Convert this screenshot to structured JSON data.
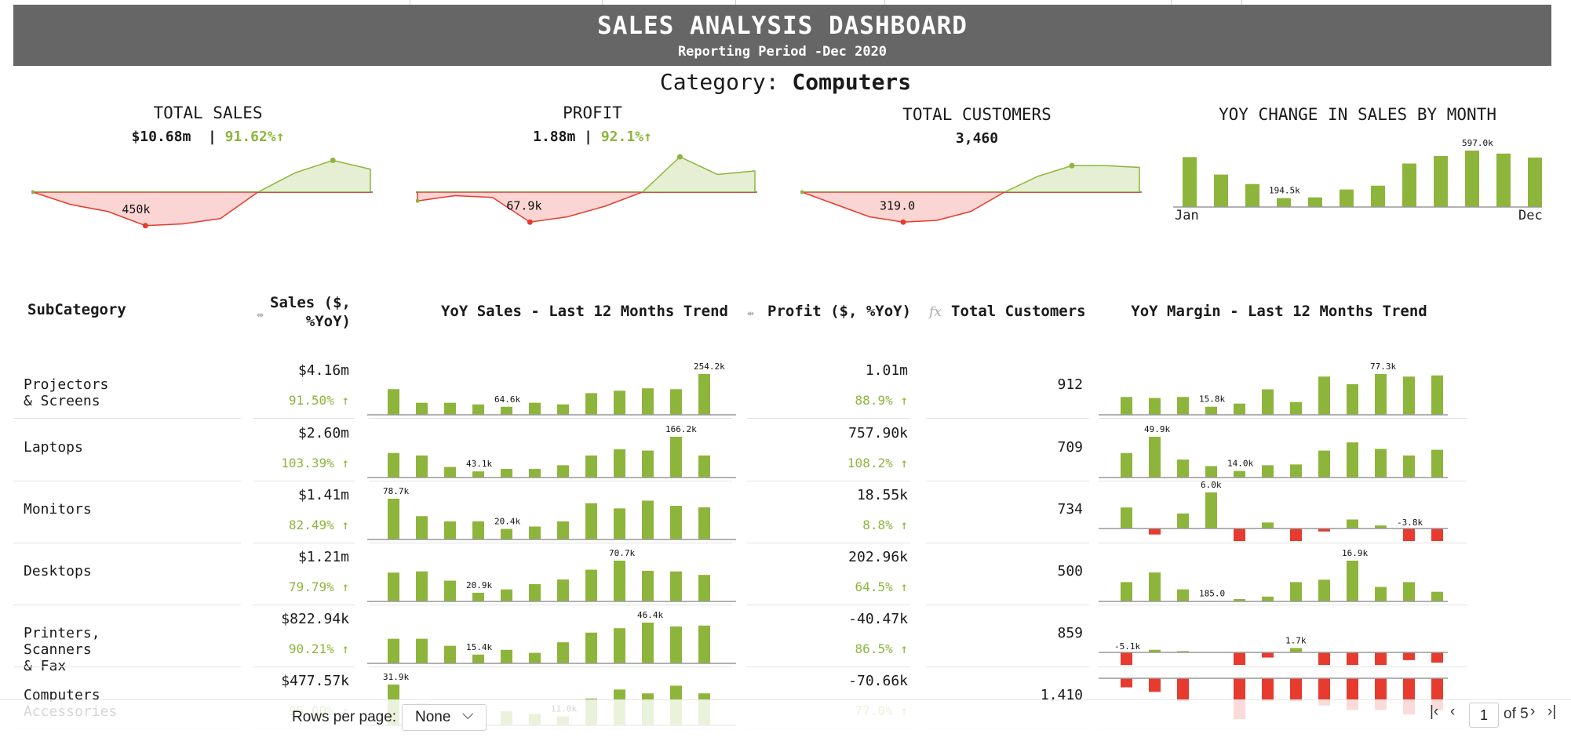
{
  "header": {
    "title": "SALES ANALYSIS DASHBOARD",
    "subtitle": "Reporting Period -Dec 2020"
  },
  "category": {
    "label": "Category:",
    "value": "Computers"
  },
  "kpis": {
    "sales": {
      "title": "TOTAL SALES",
      "value": "$10.68m",
      "sep": "|",
      "pct": "91.62%",
      "low_label": "450k"
    },
    "profit": {
      "title": "PROFIT",
      "value": "1.88m",
      "sep": "|",
      "pct": "92.1%",
      "low_label": "67.9k"
    },
    "customers": {
      "title": "TOTAL CUSTOMERS",
      "value": "3,460",
      "low_label": "319.0"
    },
    "yoy": {
      "title": "YOY CHANGE IN SALES BY MONTH",
      "start": "Jan",
      "end": "Dec",
      "peak_label": "597.0k",
      "low_label": "194.5k"
    }
  },
  "table": {
    "headers": {
      "subcategory": "SubCategory",
      "sales_l1": "Sales ($,",
      "sales_l2": "%YoY)",
      "sales_trend": "YoY Sales - Last 12 Months Trend",
      "profit": "Profit ($, %YoY)",
      "customers": "Total Customers",
      "margin_trend": "YoY Margin - Last 12 Months Trend"
    },
    "rows": [
      {
        "name": "Projectors & Screens",
        "sales": "$4.16m",
        "sales_pct": "91.50%",
        "profit": "1.01m",
        "profit_pct": "88.9%",
        "customers": "912",
        "s_max": "254.2k",
        "s_min": "64.6k",
        "m_max": "77.3k",
        "m_min": "15.8k"
      },
      {
        "name": "Laptops",
        "sales": "$2.60m",
        "sales_pct": "103.39%",
        "profit": "757.90k",
        "profit_pct": "108.2%",
        "customers": "709",
        "s_max": "166.2k",
        "s_min": "43.1k",
        "m_max": "49.9k",
        "m_min": "14.0k"
      },
      {
        "name": "Monitors",
        "sales": "$1.41m",
        "sales_pct": "82.49%",
        "profit": "18.55k",
        "profit_pct": "8.8%",
        "customers": "734",
        "s_max": "78.7k",
        "s_min": "20.4k",
        "m_max": "6.0k",
        "m_min": "-3.8k"
      },
      {
        "name": "Desktops",
        "sales": "$1.21m",
        "sales_pct": "79.79%",
        "profit": "202.96k",
        "profit_pct": "64.5%",
        "customers": "500",
        "s_max": "70.7k",
        "s_min": "20.9k",
        "m_max": "16.9k",
        "m_min": "185.0"
      },
      {
        "name": "Printers, Scanners & Fax",
        "sales": "$822.94k",
        "sales_pct": "90.21%",
        "profit": "-40.47k",
        "profit_pct": "86.5%",
        "customers": "859",
        "s_max": "46.4k",
        "s_min": "15.4k",
        "m_max": "1.7k",
        "m_min": "-5.1k"
      },
      {
        "name": "Computers Accessories",
        "sales": "$477.57k",
        "sales_pct": "95.00%",
        "profit": "-70.66k",
        "profit_pct": "77.0%",
        "customers": "1,410",
        "s_max": "31.9k",
        "s_min": "11.0k",
        "m_max": "",
        "m_min": ""
      }
    ]
  },
  "sparklines": {
    "sales_kpi": [
      0.0,
      -0.35,
      -0.55,
      -0.95,
      -0.9,
      -0.75,
      0.0,
      0.55,
      0.9,
      0.65
    ],
    "profit_kpi": [
      -0.25,
      -0.1,
      -0.15,
      -0.85,
      -0.7,
      -0.4,
      0.0,
      1.0,
      0.5,
      0.6
    ],
    "customers_kpi": [
      0.0,
      -0.35,
      -0.7,
      -0.85,
      -0.8,
      -0.55,
      0.0,
      0.45,
      0.75,
      0.75,
      0.7
    ],
    "yoy_bars": [
      528,
      343,
      243,
      94,
      102,
      185,
      226,
      460,
      539,
      597,
      565,
      523
    ]
  },
  "rows_trend": {
    "sales": [
      [
        160,
        75,
        75,
        64.6,
        50,
        75,
        65,
        135,
        150,
        165,
        160,
        254.2
      ],
      [
        100,
        90,
        43.1,
        25,
        35,
        35,
        50,
        90,
        115,
        110,
        166.2,
        90
      ],
      [
        78.7,
        45,
        35,
        35,
        20.4,
        25,
        35,
        70,
        60,
        75,
        65,
        62
      ],
      [
        50,
        52,
        36,
        15,
        20.9,
        30,
        38,
        55,
        70.7,
        53,
        52,
        46
      ],
      [
        28,
        28,
        20,
        10,
        15.4,
        12,
        24,
        35,
        40,
        46.4,
        42,
        43
      ],
      [
        31.9,
        17,
        12,
        8,
        11.0,
        9,
        7,
        21,
        28,
        25,
        31,
        25
      ]
    ],
    "margin": [
      [
        35,
        33,
        35,
        15.8,
        22,
        50,
        25,
        75,
        60,
        80,
        75,
        77.3
      ],
      [
        30,
        49.9,
        22,
        14.0,
        8,
        15,
        16,
        33,
        43,
        35,
        27,
        34
      ],
      [
        3.5,
        -1,
        2.5,
        6.0,
        -2.5,
        1,
        -3.2,
        -0.5,
        1.5,
        0.5,
        -3.8,
        -3.6
      ],
      [
        8,
        12,
        5,
        0.185,
        1,
        2,
        8,
        9,
        16.9,
        6,
        8,
        4
      ],
      [
        -14,
        1.0,
        0.5,
        0,
        -8,
        -2,
        1.7,
        -13,
        -5.1,
        -10,
        -3,
        -4
      ],
      [
        -2,
        -3,
        -5,
        0,
        -9,
        -5,
        -5,
        -6,
        -7,
        -7,
        -8,
        -7
      ]
    ]
  },
  "pager": {
    "rows_label": "Rows per page:",
    "rows_value": "None",
    "page": "1",
    "of": "of 5"
  },
  "colors": {
    "positive": "#8db53b",
    "negative": "#e63b2e",
    "banner": "#666666"
  }
}
